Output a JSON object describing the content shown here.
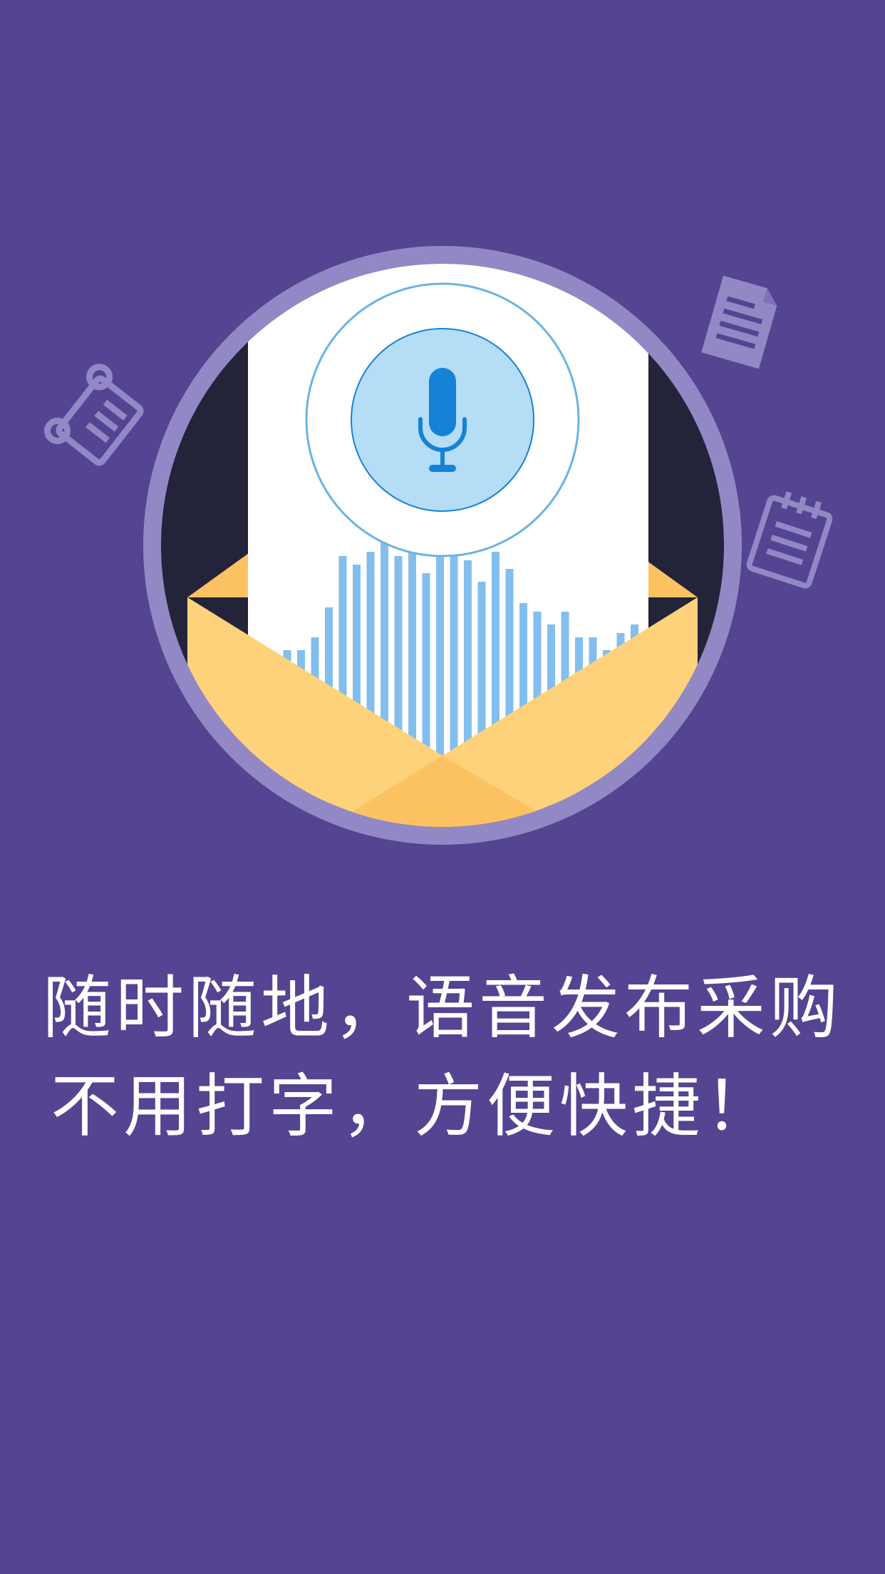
{
  "screen": {
    "background_color": "#544492",
    "caption_line1": "随时随地，语音发布采购",
    "caption_line2": "不用打字，方便快捷！"
  },
  "illustration": {
    "icons": [
      "scroll-icon",
      "document-icon",
      "notepad-icon",
      "microphone-icon"
    ],
    "colors": {
      "ring": "#9188C5",
      "circle_dark": "#23233A",
      "envelope_light": "#FDD27A",
      "envelope_dark": "#FCC262",
      "paper": "#FFFFFF",
      "mic_outer_ring": "#6AB3E2",
      "mic_inner_fill": "#B5DDF5",
      "mic": "#1582D8",
      "wave": "#83BFEE",
      "decor_icons": "#9188C5"
    }
  }
}
